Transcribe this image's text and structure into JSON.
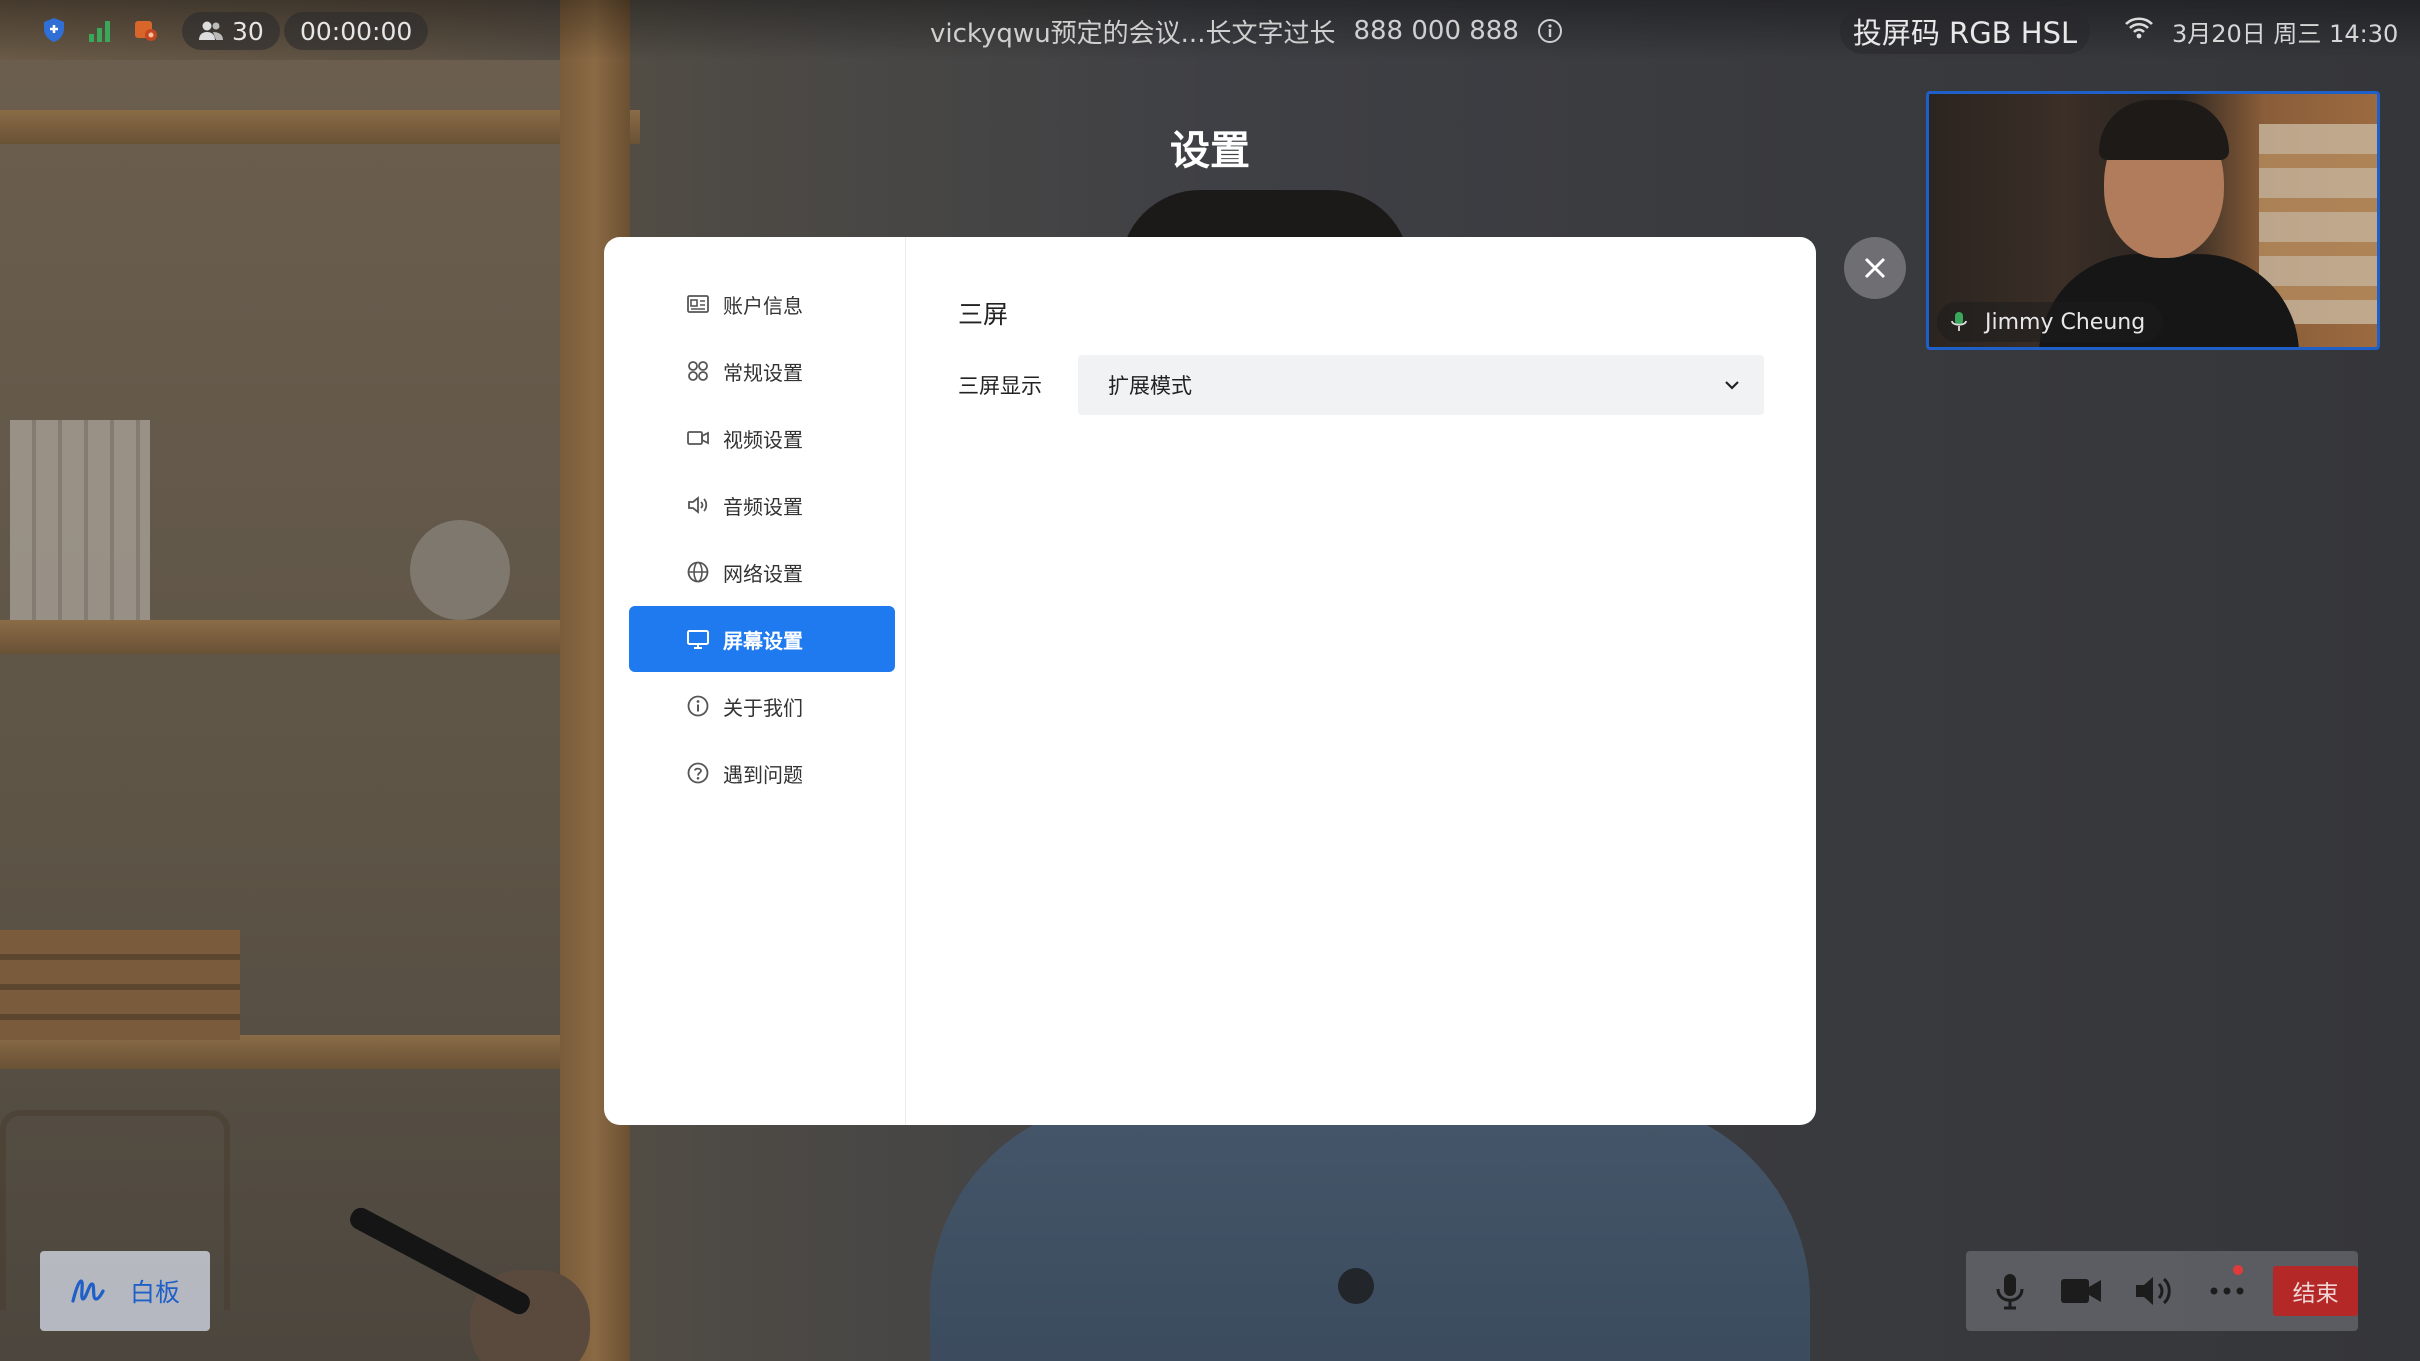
{
  "status_bar": {
    "participants": "30",
    "timer": "00:00:00",
    "meeting_title": "vickyqwu预定的会议...长文字过长",
    "meeting_id": "888 000 888",
    "screen_code": "投屏码 RGB HSL",
    "datetime": "3月20日 周三 14:30"
  },
  "settings": {
    "title": "设置",
    "nav": [
      {
        "label": "账户信息",
        "icon": "id-card-icon"
      },
      {
        "label": "常规设置",
        "icon": "grid-icon"
      },
      {
        "label": "视频设置",
        "icon": "video-camera-icon"
      },
      {
        "label": "音频设置",
        "icon": "speaker-icon"
      },
      {
        "label": "网络设置",
        "icon": "globe-icon"
      },
      {
        "label": "屏幕设置",
        "icon": "monitor-icon"
      },
      {
        "label": "关于我们",
        "icon": "info-icon"
      },
      {
        "label": "遇到问题",
        "icon": "question-icon"
      }
    ],
    "active_nav": "屏幕设置",
    "section_title": "三屏",
    "field_label": "三屏显示",
    "field_value": "扩展模式"
  },
  "video_tile": {
    "name": "Jimmy Cheung"
  },
  "bottom": {
    "whiteboard_label": "白板",
    "end_label": "结束"
  },
  "colors": {
    "accent": "#1f7af0",
    "end_button": "#b42828",
    "tile_border": "#1f5fc8"
  }
}
